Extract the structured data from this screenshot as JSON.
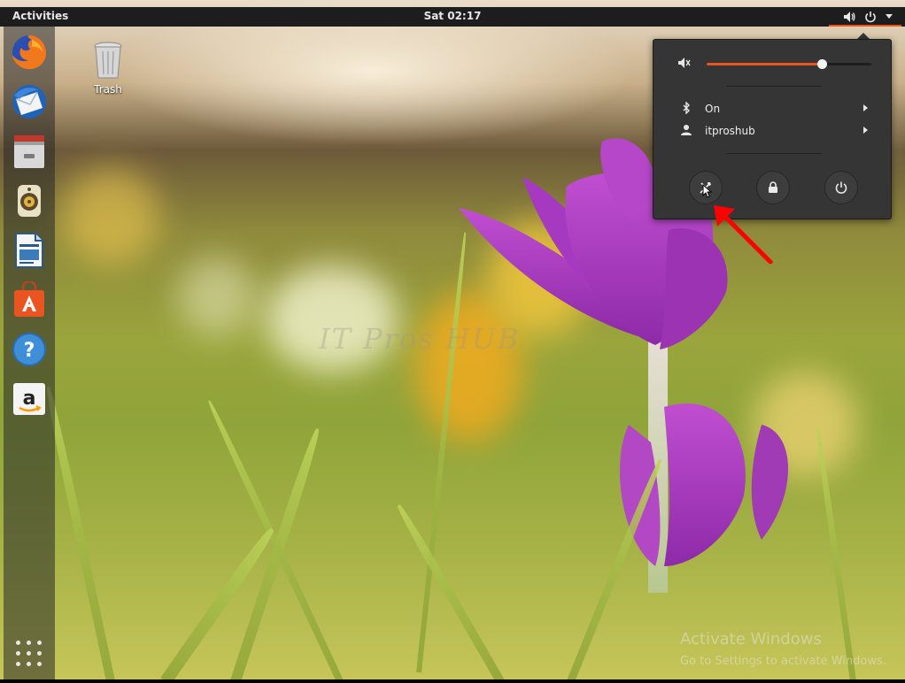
{
  "topbar": {
    "activities_label": "Activities",
    "clock": "Sat 02:17",
    "indicators": [
      "speaker-icon",
      "power-icon",
      "chevron-down-icon"
    ],
    "accent_color": "#e95420"
  },
  "dock": {
    "items": [
      {
        "name": "firefox",
        "icon": "firefox-icon"
      },
      {
        "name": "thunderbird",
        "icon": "thunderbird-icon"
      },
      {
        "name": "files",
        "icon": "files-icon"
      },
      {
        "name": "rhythmbox",
        "icon": "rhythmbox-icon"
      },
      {
        "name": "libreoffice-writer",
        "icon": "writer-icon"
      },
      {
        "name": "ubuntu-software",
        "icon": "software-icon"
      },
      {
        "name": "help",
        "icon": "help-icon"
      },
      {
        "name": "amazon",
        "icon": "amazon-icon"
      }
    ],
    "show_apps_icon": "grid-icon"
  },
  "desktop": {
    "trash_label": "Trash"
  },
  "system_menu": {
    "volume_level": 0.7,
    "volume_icon": "speaker-muted-icon",
    "bluetooth_label": "On",
    "user_label": "itproshub",
    "buttons": [
      "settings-icon",
      "lock-icon",
      "power-icon"
    ]
  },
  "watermarks": {
    "brand": "IT Pros HUB",
    "activate_title": "Activate Windows",
    "activate_sub": "Go to Settings to activate Windows."
  }
}
